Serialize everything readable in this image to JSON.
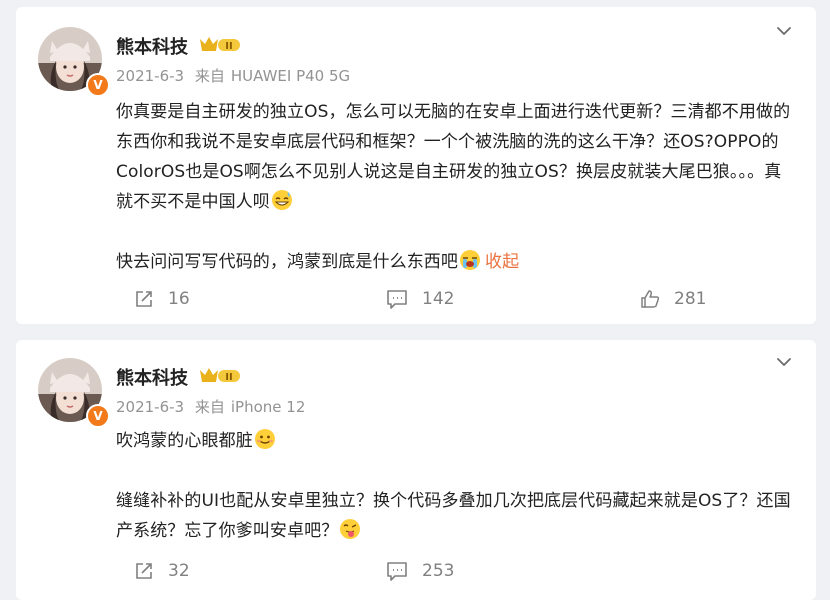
{
  "posts": [
    {
      "username": "熊本科技",
      "badge_text": "II",
      "verified_mark": "V",
      "date": "2021-6-3",
      "source_prefix": "来自",
      "device": "HUAWEI P40 5G",
      "paragraphs": [
        "你真要是自主研发的独立OS，怎么可以无脑的在安卓上面进行迭代更新？三清都不用做的东西你和我说不是安卓底层代码和框架？一个个被洗脑的洗的这么干净？还OS?OPPO的ColorOS也是OS啊怎么不见别人说这是自主研发的独立OS？换层皮就装大尾巴狼。。。真就不买不是中国人呗",
        "快去问问写写代码的，鸿蒙到底是什么东西吧"
      ],
      "collapse_label": "收起",
      "repost_count": "16",
      "comment_count": "142",
      "like_count": "281"
    },
    {
      "username": "熊本科技",
      "badge_text": "II",
      "verified_mark": "V",
      "date": "2021-6-3",
      "source_prefix": "来自",
      "device": "iPhone 12",
      "paragraphs": [
        "吹鸿蒙的心眼都脏",
        "缝缝补补的UI也配从安卓里独立？换个代码多叠加几次把底层代码藏起来就是OS了？还国产系统？忘了你爹叫安卓吧？"
      ],
      "repost_count": "32",
      "comment_count": "253"
    }
  ],
  "icons": {
    "chevron": "chevron-down-icon",
    "repost": "repost-icon",
    "comment": "comment-icon",
    "like": "like-icon",
    "verified": "verified-icon",
    "badge": "member-badge-icon",
    "emojis": [
      "grin-sweat-emoji",
      "crying-emoji",
      "smile-emoji",
      "tongue-emoji"
    ]
  },
  "colors": {
    "accent": "#eb7340",
    "verified": "#f27a1a",
    "badge_gold": "#e9b21a",
    "meta_gray": "#939393",
    "page_bg": "#eff1f4"
  }
}
